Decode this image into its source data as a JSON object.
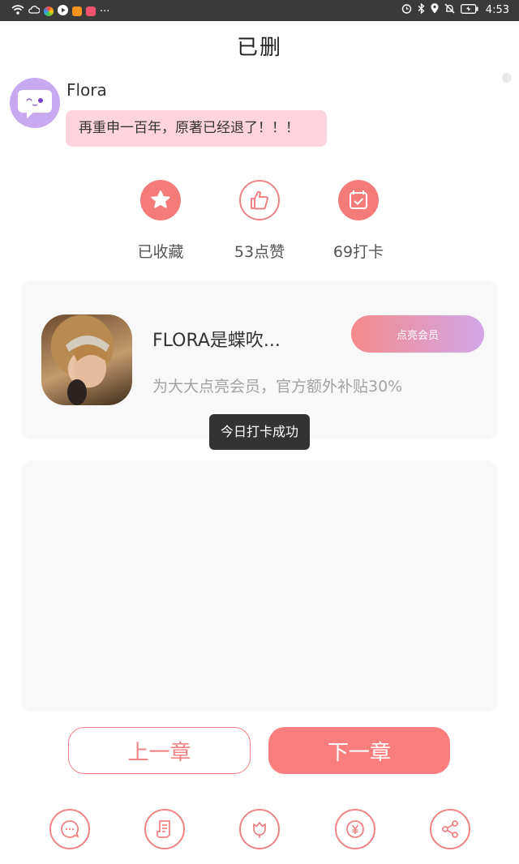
{
  "status_bar": {
    "time": "4:53",
    "more": "···"
  },
  "header": {
    "title": "已删"
  },
  "post": {
    "author": "Flora",
    "message": "再重申一百年，原著已经退了！！！"
  },
  "stats": [
    {
      "label": "已收藏",
      "icon": "star-icon"
    },
    {
      "label": "53点赞",
      "icon": "thumbs-up-icon"
    },
    {
      "label": "69打卡",
      "icon": "calendar-check-icon"
    }
  ],
  "member_card": {
    "name": "FLORA是蝶吹...",
    "subtitle": "为大大点亮会员，官方额外补贴30%",
    "button_label": "点亮会员"
  },
  "toast": {
    "text": "今日打卡成功"
  },
  "chapter_nav": {
    "prev_label": "上一章",
    "next_label": "下一章"
  },
  "toolbar": {
    "items": [
      "comment-icon",
      "notes-icon",
      "flower-icon",
      "yen-coin-icon",
      "share-icon"
    ]
  },
  "colors": {
    "accent": "#f57b7b",
    "bubble": "#ffd4de",
    "avatar_bg": "#c7a9f2",
    "card_bg": "#f8f8f8",
    "toast_bg": "#333333"
  }
}
